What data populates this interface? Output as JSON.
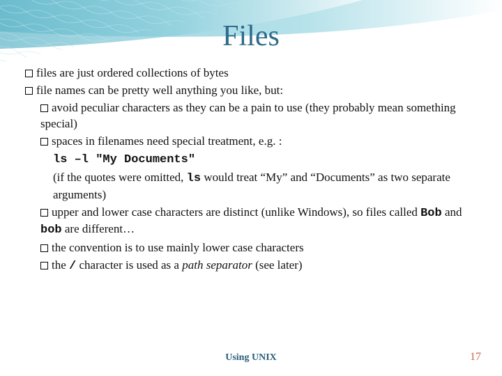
{
  "title": "Files",
  "bullets": {
    "b1": "files are just ordered collections of bytes",
    "b2": "file names can be pretty well anything you like, but:",
    "b2_1": "avoid peculiar characters as they can be a pain to use (they probably mean something special)",
    "b2_2": "spaces in filenames need special treatment, e.g. :",
    "b2_2_cmd": "ls –l \"My Documents\"",
    "b2_2_note_a": "(if the quotes were omitted, ",
    "b2_2_note_b": " would treat “My” and “Documents” as two separate arguments)",
    "b2_3_a": "upper and lower case characters are distinct (unlike Windows), so files called ",
    "b2_3_b": " and ",
    "b2_3_c": " are different…",
    "b2_4": "the convention is to use mainly lower case characters",
    "b2_5_a": "the ",
    "b2_5_b": " character is used as a ",
    "b2_5_c": " (see later)"
  },
  "code": {
    "ls": "ls",
    "bob1": "Bob",
    "bob2": "bob",
    "slash": "/"
  },
  "italic": {
    "pathsep": "path separator"
  },
  "footer": "Using UNIX",
  "pagenum": "17"
}
